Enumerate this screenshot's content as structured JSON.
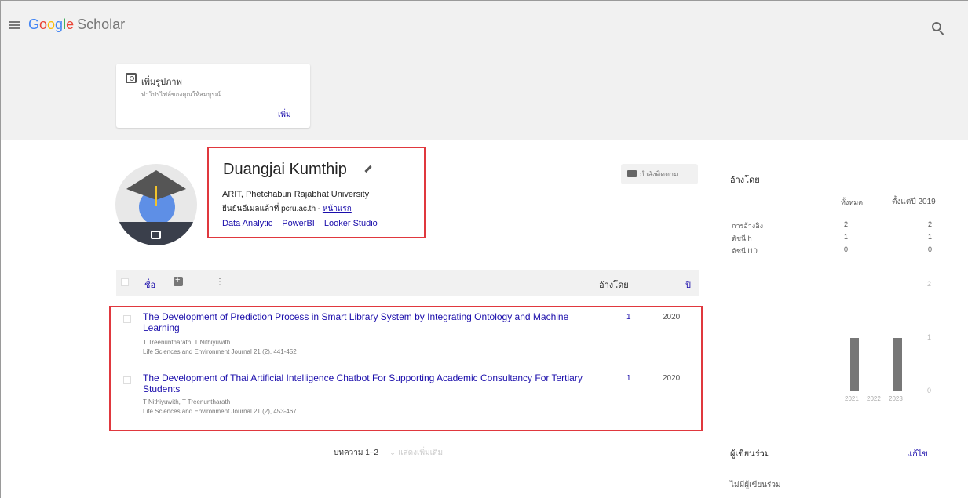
{
  "header": {
    "logo_letters": [
      "G",
      "o",
      "o",
      "g",
      "l",
      "e"
    ],
    "logo_suffix": "Scholar"
  },
  "photo_card": {
    "title": "เพิ่มรูปภาพ",
    "subtitle": "ทำโปรไฟล์ของคุณให้สมบูรณ์",
    "add_label": "เพิ่ม"
  },
  "profile": {
    "name": "Duangjai Kumthip",
    "affiliation": "ARIT, Phetchabun Rajabhat University",
    "verified_text": "ยืนยันอีเมลแล้วที่ pcru.ac.th - ",
    "homepage_label": "หน้าแรก",
    "interests": [
      "Data Analytic",
      "PowerBI",
      "Looker Studio"
    ],
    "follow_label": "กำลังติดตาม"
  },
  "table": {
    "title_col": "ชื่อ",
    "more_icon": "⋮",
    "cited_by_col": "อ้างโดย",
    "year_col": "ปี",
    "articles": [
      {
        "title": "The Development of Prediction Process in Smart Library System by Integrating Ontology and Machine Learning",
        "authors": "T Treenuntharath, T Nithiyuwith",
        "journal": "Life Sciences and Environment Journal 21 (2), 441-452",
        "cited_by": "1",
        "year": "2020"
      },
      {
        "title": "The Development of Thai Artificial Intelligence Chatbot For Supporting Academic Consultancy For Tertiary Students",
        "authors": "T Nithiyuwith, T Treenuntharath",
        "journal": "Life Sciences and Environment Journal 21 (2), 453-467",
        "cited_by": "1",
        "year": "2020"
      }
    ],
    "pager_text": "บทความ 1–2",
    "show_more": "แสดงเพิ่มเติม"
  },
  "cited_panel": {
    "title": "อ้างโดย",
    "col_all": "ทั้งหมด",
    "col_since": "ตั้งแต่ปี 2019",
    "rows": [
      {
        "label": "การอ้างอิง",
        "all": "2",
        "since": "2"
      },
      {
        "label": "ดัชนี h",
        "all": "1",
        "since": "1"
      },
      {
        "label": "ดัชนี i10",
        "all": "0",
        "since": "0"
      }
    ]
  },
  "chart_data": {
    "type": "bar",
    "categories": [
      "2021",
      "2022",
      "2023"
    ],
    "values": [
      1,
      0,
      1
    ],
    "y_ticks": [
      "2",
      "1",
      "0"
    ],
    "ylim": [
      0,
      2
    ]
  },
  "coauthors": {
    "title": "ผู้เขียนร่วม",
    "edit_label": "แก้ไข",
    "empty_text": "ไม่มีผู้เขียนร่วม"
  },
  "colors": {
    "link": "#1a0dab",
    "highlight_border": "#e0383e",
    "bar": "#777777"
  }
}
